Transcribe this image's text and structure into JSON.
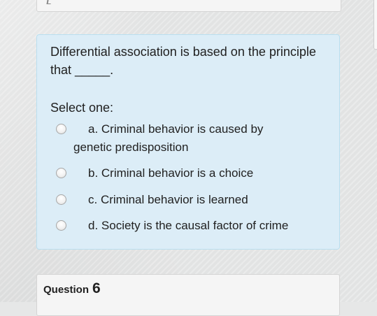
{
  "question": {
    "text": "Differential association is based on the principle that _____.",
    "select_label": "Select one:",
    "options": [
      {
        "text_line1": "a. Criminal behavior is caused by",
        "text_line2": "genetic predisposition",
        "selected": false
      },
      {
        "text": "b. Criminal behavior is a choice",
        "selected": false
      },
      {
        "text": "c. Criminal behavior is learned",
        "selected": false
      },
      {
        "text": "d. Society is the causal factor of crime",
        "selected": false
      }
    ]
  },
  "next_question": {
    "label": "Question",
    "number": "6"
  },
  "colors": {
    "card_bg": "#dcedf7",
    "card_border": "#b9dff0",
    "page_bg": "#e6e7e7",
    "text": "#212121"
  }
}
